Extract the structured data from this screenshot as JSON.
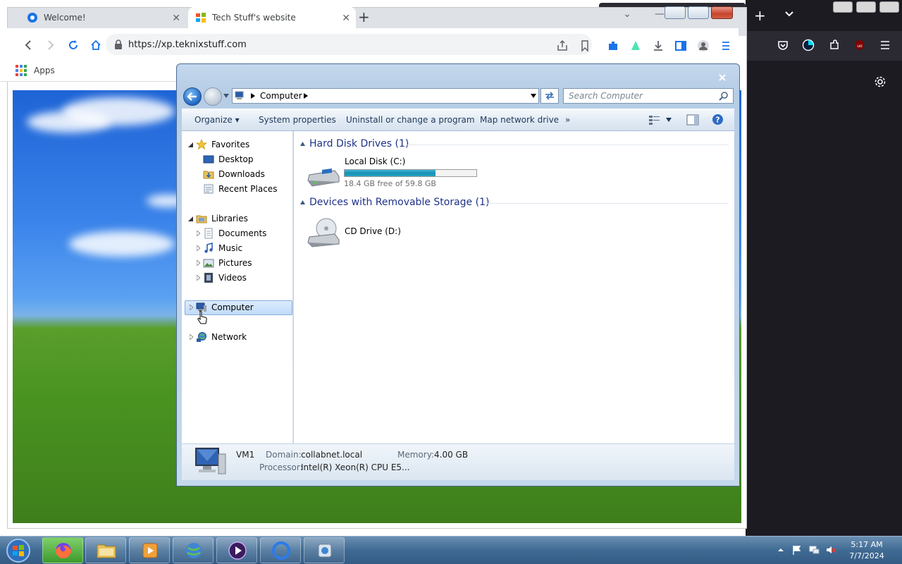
{
  "firefox": {
    "tray_icons": [
      "pocket-icon",
      "account-icon",
      "extensions-icon",
      "ublock-icon",
      "menu-icon"
    ]
  },
  "chrome": {
    "tabs": [
      {
        "title": "Welcome!",
        "active": false
      },
      {
        "title": "Tech Stuff's website",
        "active": true
      }
    ],
    "url": "https://xp.teknixstuff.com",
    "bookmarks": {
      "apps_label": "Apps"
    }
  },
  "explorer": {
    "address_crumb": "Computer",
    "search_placeholder": "Search Computer",
    "commands": {
      "organize": "Organize",
      "system_properties": "System properties",
      "uninstall": "Uninstall or change a program",
      "map_drive": "Map network drive",
      "more": "»"
    },
    "nav": {
      "favorites": "Favorites",
      "desktop": "Desktop",
      "downloads": "Downloads",
      "recent": "Recent Places",
      "libraries": "Libraries",
      "documents": "Documents",
      "music": "Music",
      "pictures": "Pictures",
      "videos": "Videos",
      "computer": "Computer",
      "network": "Network"
    },
    "groups": {
      "hdd": "Hard Disk Drives (1)",
      "removable": "Devices with Removable Storage (1)"
    },
    "drives": {
      "c_name": "Local Disk (C:)",
      "c_free": "18.4 GB free of 59.8 GB",
      "c_used_fraction": 0.69,
      "d_name": "CD Drive (D:)"
    },
    "details": {
      "name": "VM1",
      "domain_label": "Domain:",
      "domain": "collabnet.local",
      "memory_label": "Memory:",
      "memory": "4.00 GB",
      "processor_label": "Processor:",
      "processor": "Intel(R) Xeon(R) CPU E5..."
    }
  },
  "taskbar": {
    "time": "5:17 AM",
    "date": "7/7/2024"
  },
  "colors": {
    "accent_chrome": "#1a73e8",
    "explorer_frame": "#b6cde6",
    "taskbar": "#3f6a93"
  }
}
